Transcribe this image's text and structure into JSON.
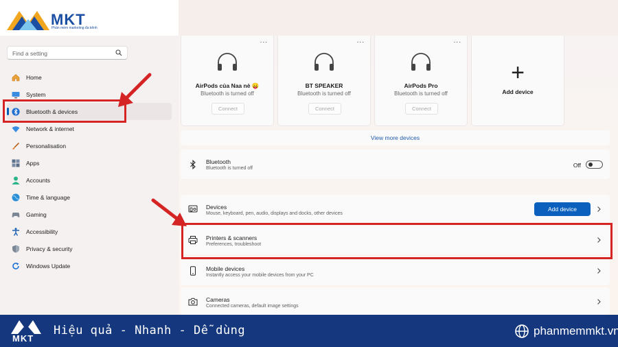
{
  "brand": {
    "name": "MKT",
    "tagline": "Phần mềm marketing đa kênh"
  },
  "search": {
    "placeholder": "Find a setting"
  },
  "sidebar": {
    "items": [
      {
        "label": "Home",
        "icon": "home-icon"
      },
      {
        "label": "System",
        "icon": "monitor-icon"
      },
      {
        "label": "Bluetooth & devices",
        "icon": "bluetooth-icon",
        "active": true
      },
      {
        "label": "Network & internet",
        "icon": "wifi-icon"
      },
      {
        "label": "Personalisation",
        "icon": "brush-icon"
      },
      {
        "label": "Apps",
        "icon": "apps-icon"
      },
      {
        "label": "Accounts",
        "icon": "person-icon"
      },
      {
        "label": "Time & language",
        "icon": "globe-icon"
      },
      {
        "label": "Gaming",
        "icon": "gamepad-icon"
      },
      {
        "label": "Accessibility",
        "icon": "accessibility-icon"
      },
      {
        "label": "Privacy & security",
        "icon": "shield-icon"
      },
      {
        "label": "Windows Update",
        "icon": "update-icon"
      }
    ]
  },
  "devices": [
    {
      "name": "AirPods của Naa nè 😛",
      "status": "Bluetooth is turned off",
      "connect": "Connect",
      "more": "..."
    },
    {
      "name": "BT SPEAKER",
      "status": "Bluetooth is turned off",
      "connect": "Connect",
      "more": "..."
    },
    {
      "name": "AirPods Pro",
      "status": "Bluetooth is turned off",
      "connect": "Connect",
      "more": "..."
    }
  ],
  "add_device_card": {
    "label": "Add device"
  },
  "view_more": "View more devices",
  "bluetooth_row": {
    "title": "Bluetooth",
    "subtitle": "Bluetooth is turned off",
    "toggle_label": "Off"
  },
  "rows": [
    {
      "title": "Devices",
      "subtitle": "Mouse, keyboard, pen, audio, displays and docks, other devices",
      "button": "Add device"
    },
    {
      "title": "Printers & scanners",
      "subtitle": "Preferences, troubleshoot"
    },
    {
      "title": "Mobile devices",
      "subtitle": "Instantly access your mobile devices from your PC"
    },
    {
      "title": "Cameras",
      "subtitle": "Connected cameras, default image settings"
    }
  ],
  "banner": {
    "name": "MKT",
    "slogan": "Hiệu quả - Nhanh  - Dễ dùng",
    "site": "phanmemmkt.vn"
  },
  "colors": {
    "accent": "#005fb8",
    "highlight": "#d42424",
    "banner": "#14377e"
  }
}
